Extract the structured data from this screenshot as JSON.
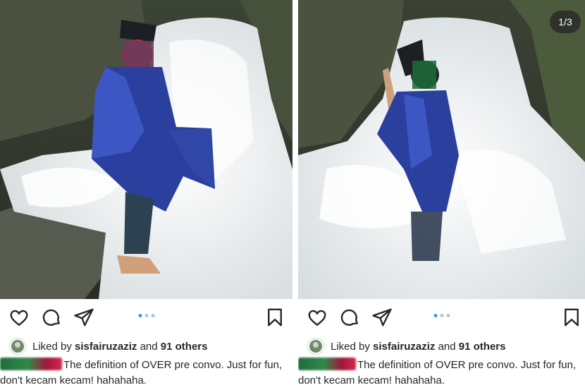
{
  "posts": [
    {
      "photo_alt": "photo",
      "counter": "",
      "liked_by_prefix": "Liked by ",
      "liked_by_user": "sisfairuzaziz",
      "liked_by_mid": " and ",
      "liked_by_others": "91 others",
      "caption_text": "The definition of OVER pre convo. Just for fun, don't kecam kecam! hahahaha.",
      "carousel_dots": 3,
      "active_dot": 0
    },
    {
      "photo_alt": "photo",
      "counter": "1/3",
      "liked_by_prefix": "Liked by ",
      "liked_by_user": "sisfairuzaziz",
      "liked_by_mid": " and ",
      "liked_by_others": "91 others",
      "caption_text": "The definition of OVER pre convo. Just for fun, don't kecam kecam! hahahaha.",
      "carousel_dots": 3,
      "active_dot": 0
    }
  ],
  "icons": {
    "like": "heart-icon",
    "comment": "comment-icon",
    "share": "share-icon",
    "save": "bookmark-icon"
  },
  "colors": {
    "robe": "#2b3f9e",
    "water": "#f4f6f7",
    "rock": "#3a3b35",
    "blue_dot": "#3897f0"
  }
}
